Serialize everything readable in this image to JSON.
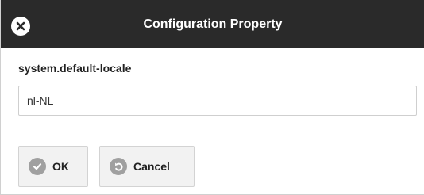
{
  "dialog": {
    "title": "Configuration Property",
    "close_icon": "close-icon"
  },
  "field": {
    "label": "system.default-locale",
    "value": "nl-NL"
  },
  "buttons": {
    "ok_label": "OK",
    "ok_icon": "check-circle-icon",
    "cancel_label": "Cancel",
    "cancel_icon": "undo-circle-icon"
  },
  "colors": {
    "titlebar_bg": "#2a2a2a",
    "button_bg": "#f2f2f2",
    "icon_gray": "#a0a0a0"
  }
}
